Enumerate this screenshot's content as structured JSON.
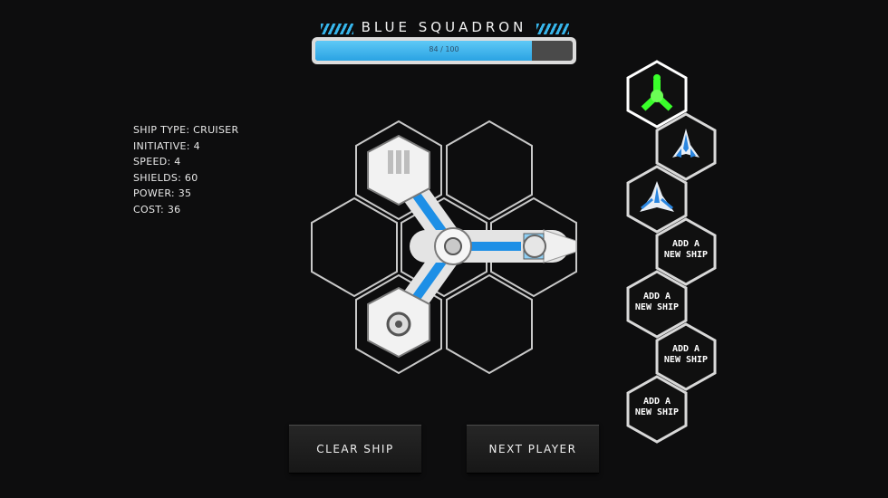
{
  "header": {
    "title": "BLUE SQUADRON"
  },
  "progress": {
    "label": "84 / 100",
    "value": 84,
    "max": 100
  },
  "stats": [
    {
      "text": "SHIP TYPE: CRUISER"
    },
    {
      "text": "INITIATIVE: 4"
    },
    {
      "text": "SPEED: 4"
    },
    {
      "text": "SHIELDS: 60"
    },
    {
      "text": "POWER: 35"
    },
    {
      "text": "COST: 36"
    }
  ],
  "roster": [
    {
      "type": "ship",
      "icon": "green-cruiser-icon",
      "selected": true
    },
    {
      "type": "ship",
      "icon": "blue-fighter-icon",
      "selected": false
    },
    {
      "type": "ship",
      "icon": "blue-interceptor-icon",
      "selected": false
    },
    {
      "type": "empty",
      "label_line1": "ADD A",
      "label_line2": "NEW SHIP"
    },
    {
      "type": "empty",
      "label_line1": "ADD A",
      "label_line2": "NEW SHIP"
    },
    {
      "type": "empty",
      "label_line1": "ADD A",
      "label_line2": "NEW SHIP"
    },
    {
      "type": "empty",
      "label_line1": "ADD A",
      "label_line2": "NEW SHIP"
    }
  ],
  "buttons": {
    "clear": "CLEAR SHIP",
    "next": "NEXT PLAYER"
  },
  "colors": {
    "accent": "#37b6ec",
    "selected": "#39ff2a",
    "hex_outline": "#c9c9c9",
    "background": "#0d0d0e"
  }
}
